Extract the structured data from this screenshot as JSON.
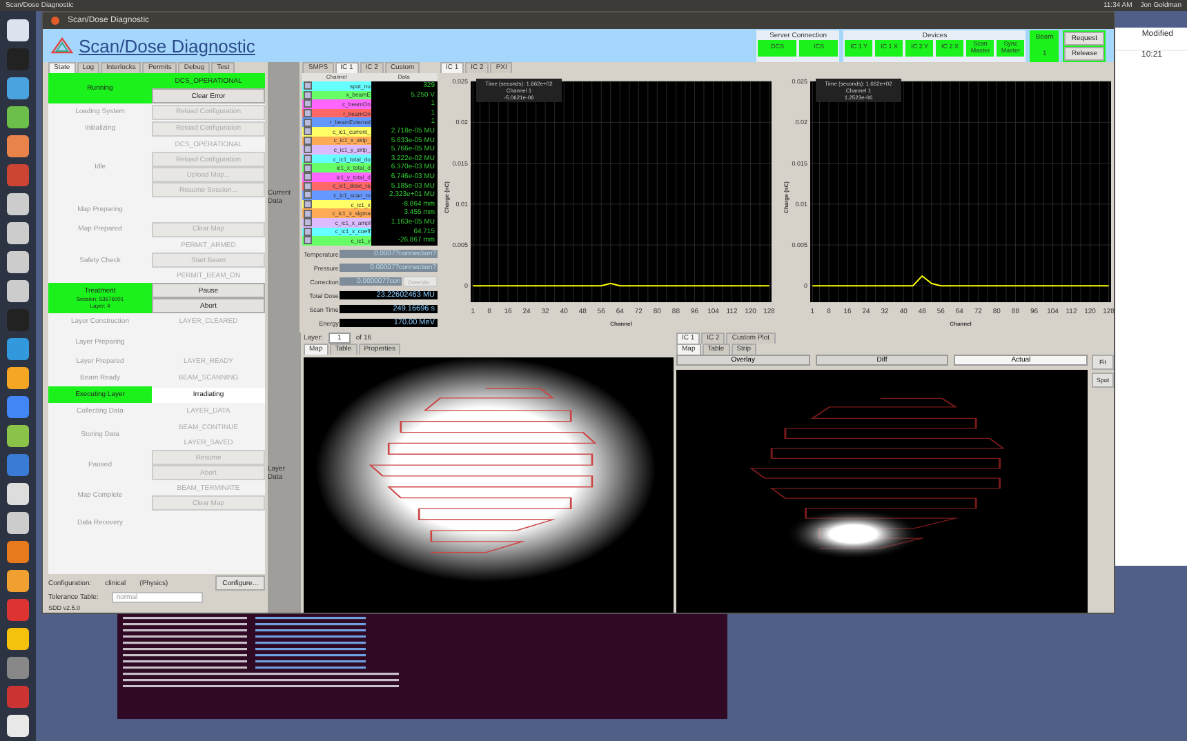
{
  "desktop": {
    "top_bar": {
      "app_title": "Scan/Dose Diagnostic",
      "clock": "11:34 AM",
      "user": "Jon Goldman"
    },
    "file_window": {
      "column": "Modified",
      "cell": "10:21"
    }
  },
  "window": {
    "title": "Scan/Dose Diagnostic",
    "app_name": "Scan/Dose Diagnostic"
  },
  "connections": {
    "server_label": "Server Connection",
    "servers": [
      {
        "label": "DCS",
        "on": true
      },
      {
        "label": "ICS",
        "on": true
      }
    ],
    "devices_label": "Devices",
    "devices": [
      {
        "label": "IC 1 Y",
        "on": true
      },
      {
        "label": "IC 1 X",
        "on": true
      },
      {
        "label": "IC 2 Y",
        "on": true
      },
      {
        "label": "IC 2 X",
        "on": true
      },
      {
        "label": "Scan Master",
        "on": true
      },
      {
        "label": "Sync Master",
        "on": true
      }
    ],
    "beam_label": "Beam",
    "beam_value": "1",
    "buttons": [
      "Request",
      "Release"
    ]
  },
  "tabs": [
    {
      "label": "State",
      "selected": true
    },
    {
      "label": "Log",
      "selected": false
    },
    {
      "label": "Interlocks",
      "selected": false
    },
    {
      "label": "Permits",
      "selected": false
    },
    {
      "label": "Debug",
      "selected": false
    },
    {
      "label": "Test",
      "selected": false
    }
  ],
  "states": [
    {
      "label": "Running",
      "active": true,
      "controls": [
        {
          "kind": "status",
          "text": "DCS_OPERATIONAL",
          "on": true
        },
        {
          "kind": "button",
          "text": "Clear Error",
          "disabled": false
        }
      ]
    },
    {
      "label": "Loading System",
      "active": false,
      "controls": [
        {
          "kind": "button",
          "text": "Reload Configuration",
          "disabled": true
        }
      ]
    },
    {
      "label": "Initializing",
      "active": false,
      "controls": [
        {
          "kind": "button",
          "text": "Reload Configuration",
          "disabled": true
        }
      ]
    },
    {
      "label": "Idle",
      "active": false,
      "controls": [
        {
          "kind": "status",
          "text": "DCS_OPERATIONAL",
          "on": false
        },
        {
          "kind": "button",
          "text": "Reload Configuration",
          "disabled": true
        },
        {
          "kind": "button",
          "text": "Upload Map...",
          "disabled": true
        },
        {
          "kind": "button",
          "text": "Resume Session...",
          "disabled": true
        }
      ]
    },
    {
      "label": "Map Preparing",
      "active": false
    },
    {
      "label": "Map Prepared",
      "active": false,
      "controls": [
        {
          "kind": "button",
          "text": "Clear Map",
          "disabled": true
        }
      ]
    },
    {
      "label": "Safety Check",
      "active": false,
      "controls": [
        {
          "kind": "status",
          "text": "PERMIT_ARMED",
          "on": false
        },
        {
          "kind": "button",
          "text": "Start Beam",
          "disabled": true
        },
        {
          "kind": "status",
          "text": "PERMIT_BEAM_ON",
          "on": false
        }
      ]
    },
    {
      "label": "Treatment",
      "details": [
        "Session: 53676001",
        "Layer: 4"
      ],
      "active": true,
      "controls": [
        {
          "kind": "button",
          "text": "Pause",
          "disabled": false
        },
        {
          "kind": "button",
          "text": "Abort",
          "disabled": false
        }
      ]
    },
    {
      "label": "Layer Construction",
      "active": false,
      "controls": [
        {
          "kind": "status",
          "text": "LAYER_CLEARED",
          "on": false
        }
      ]
    },
    {
      "label": "Layer Preparing",
      "active": false
    },
    {
      "label": "Layer Prepared",
      "active": false,
      "controls": [
        {
          "kind": "status",
          "text": "LAYER_READY",
          "on": false
        }
      ]
    },
    {
      "label": "Beam Ready",
      "active": false,
      "controls": [
        {
          "kind": "status",
          "text": "BEAM_SCANNING",
          "on": false
        }
      ]
    },
    {
      "label": "Executing Layer",
      "active": true,
      "controls": [
        {
          "kind": "current",
          "text": "Irradiating"
        }
      ]
    },
    {
      "label": "Collecting Data",
      "active": false,
      "controls": [
        {
          "kind": "status",
          "text": "LAYER_DATA",
          "on": false
        }
      ]
    },
    {
      "label": "Storing Data",
      "active": false,
      "controls": [
        {
          "kind": "status",
          "text": "BEAM_CONTINUE",
          "on": false
        },
        {
          "kind": "status",
          "text": "LAYER_SAVED",
          "on": false
        }
      ]
    },
    {
      "label": "Paused",
      "active": false,
      "controls": [
        {
          "kind": "button",
          "text": "Resume",
          "disabled": true
        },
        {
          "kind": "button",
          "text": "Abort",
          "disabled": true
        }
      ]
    },
    {
      "label": "Map Complete",
      "active": false,
      "controls": [
        {
          "kind": "status",
          "text": "BEAM_TERMINATE",
          "on": false
        },
        {
          "kind": "button",
          "text": "Clear Map",
          "disabled": true
        }
      ]
    },
    {
      "label": "Data Recovery",
      "active": false
    }
  ],
  "footer": {
    "configuration_label": "Configuration:",
    "configuration": "clinical",
    "mode": "(Physics)",
    "configure_button": "Configure...",
    "tolerance_label": "Tolerance Table:",
    "tolerance": "normal",
    "version": "SDD v2.5.0"
  },
  "current_data": {
    "label": "Current Data",
    "tabs": [
      {
        "label": "SMPS",
        "selected": false
      },
      {
        "label": "IC 1",
        "selected": true
      },
      {
        "label": "IC 2",
        "selected": false
      },
      {
        "label": "Custom",
        "selected": false
      }
    ],
    "columns": [
      "Channel",
      "Data"
    ],
    "channels": [
      {
        "name": "spot_nu",
        "value": "329",
        "color": "#66ffff",
        "checked": true
      },
      {
        "name": "x_beamE",
        "value": "5.250 V",
        "color": "#66ff66",
        "checked": true
      },
      {
        "name": "c_beamOn",
        "value": "1",
        "color": "#ff66ff",
        "checked": true
      },
      {
        "name": "r_beamOn",
        "value": "1",
        "color": "#ff6666",
        "checked": true
      },
      {
        "name": "r_beamExternal",
        "value": "1",
        "color": "#6699ff",
        "checked": true
      },
      {
        "name": "c_ic1_current_",
        "value": "2.718e-05 MU",
        "color": "#ffff66",
        "checked": true
      },
      {
        "name": "c_ic1_x_sktp_",
        "value": "5.633e-05 MU",
        "color": "#ffaa55",
        "checked": true
      },
      {
        "name": "c_ic1_y_sktp_",
        "value": "5.766e-05 MU",
        "color": "#ddbbff",
        "checked": true
      },
      {
        "name": "c_ic1_total_do",
        "value": "3.222e-02 MU",
        "color": "#66ffff",
        "checked": true
      },
      {
        "name": "ic1_x_total_d",
        "value": "6.370e-03 MU",
        "color": "#66ff66",
        "checked": true
      },
      {
        "name": "ic1_y_total_d",
        "value": "6.746e-03 MU",
        "color": "#ff66ff",
        "checked": true
      },
      {
        "name": "c_ic1_dose_ra",
        "value": "5.185e-03 MU",
        "color": "#ff6666",
        "checked": true
      },
      {
        "name": "c_ic1_scan_to",
        "value": "2.323e+01 MU",
        "color": "#6699ff",
        "checked": true
      },
      {
        "name": "c_ic1_x",
        "value": "-8.864 mm",
        "color": "#ffff66",
        "checked": true
      },
      {
        "name": "c_ic1_x_sigma",
        "value": "3.455 mm",
        "color": "#ffaa55",
        "checked": true
      },
      {
        "name": "c_ic1_x_ampl",
        "value": "1.163e-05 MU",
        "color": "#ddbbff",
        "checked": true
      },
      {
        "name": "c_ic1_x_coeff",
        "value": "64.715",
        "color": "#66ffff",
        "checked": true
      },
      {
        "name": "c_ic1_y",
        "value": "-26.867 mm",
        "color": "#66ff66",
        "checked": true
      }
    ],
    "readouts": [
      {
        "label": "Temperature",
        "value": "0.0007?connection?"
      },
      {
        "label": "Pressure",
        "value": "0.00007?connection?"
      },
      {
        "label": "Correction",
        "value": "0.000007?con",
        "button": "Override..."
      }
    ],
    "totals": [
      {
        "label": "Total Dose",
        "value": "23.22602463 MU"
      },
      {
        "label": "Scan Time",
        "value": "249.16696 s"
      },
      {
        "label": "Energy",
        "value": "170.00 MeV"
      }
    ]
  },
  "plots": {
    "tabs": [
      {
        "label": "IC 1",
        "selected": true
      },
      {
        "label": "IC 2",
        "selected": false
      },
      {
        "label": "PXI",
        "selected": false
      }
    ],
    "charts": [
      {
        "tooltip": [
          "Time (seconds): 1.662e+02",
          "Channel 1",
          "-5.0621e-06"
        ],
        "chart_data": {
          "type": "line",
          "xlabel": "Channel",
          "ylabel": "Charge (nC)",
          "x": [
            1,
            4,
            8,
            12,
            16,
            20,
            24,
            28,
            32,
            36,
            40,
            44,
            48,
            52,
            56,
            60,
            64,
            68,
            72,
            76,
            80,
            84,
            88,
            92,
            96,
            100,
            104,
            108,
            112,
            116,
            120,
            124,
            128
          ],
          "series": [
            {
              "color": "#ffff00",
              "values": [
                0,
                0,
                0,
                0,
                0,
                0,
                0,
                0,
                0,
                0,
                0,
                0,
                0,
                0,
                0,
                0.0003,
                0,
                0,
                0,
                0,
                0,
                0,
                0,
                0,
                0,
                0,
                0,
                0,
                0,
                0,
                0,
                0,
                0
              ]
            }
          ],
          "xlim": [
            0,
            129
          ],
          "ylim": [
            -0.002,
            0.025
          ],
          "grid": true,
          "yticks": [
            0,
            0.005,
            0.01,
            0.015,
            0.02,
            0.025
          ],
          "xticks": [
            1,
            8,
            16,
            24,
            32,
            40,
            48,
            56,
            64,
            72,
            80,
            88,
            96,
            104,
            112,
            120,
            128
          ]
        }
      },
      {
        "tooltip": [
          "Time (seconds): 1.662e+02",
          "Channel 1",
          "1.2523e-06"
        ],
        "chart_data": {
          "type": "line",
          "xlabel": "Channel",
          "ylabel": "Charge (nC)",
          "x": [
            1,
            4,
            8,
            12,
            16,
            20,
            24,
            28,
            32,
            36,
            40,
            44,
            48,
            52,
            56,
            60,
            64,
            68,
            72,
            76,
            80,
            84,
            88,
            92,
            96,
            100,
            104,
            108,
            112,
            116,
            120,
            124,
            128
          ],
          "series": [
            {
              "color": "#ffff00",
              "values": [
                0,
                0,
                0,
                0,
                0,
                0,
                0,
                0,
                0,
                0,
                0,
                0,
                0.0012,
                0.0003,
                0,
                0,
                0,
                0,
                0,
                0,
                0,
                0,
                0,
                0,
                0,
                0,
                0,
                0,
                0,
                0,
                0,
                0,
                0
              ]
            }
          ],
          "xlim": [
            0,
            129
          ],
          "ylim": [
            -0.002,
            0.025
          ],
          "grid": true,
          "yticks": [
            0,
            0.005,
            0.01,
            0.015,
            0.02,
            0.025
          ],
          "xticks": [
            1,
            8,
            16,
            24,
            32,
            40,
            48,
            56,
            64,
            72,
            80,
            88,
            96,
            104,
            112,
            120,
            128
          ]
        }
      }
    ]
  },
  "layer_data": {
    "label": "Layer Data",
    "layer_label": "Layer:",
    "layer_value": "1",
    "of_label": "of 16",
    "tabs": [
      {
        "label": "Map",
        "selected": true
      },
      {
        "label": "Table",
        "selected": false
      },
      {
        "label": "Properties",
        "selected": false
      }
    ]
  },
  "comparison": {
    "tabs": [
      {
        "label": "IC 1",
        "selected": true
      },
      {
        "label": "IC 2",
        "selected": false
      },
      {
        "label": "Custom Plot",
        "selected": false
      }
    ],
    "sub_tabs": [
      {
        "label": "Map",
        "selected": true
      },
      {
        "label": "Table",
        "selected": false
      },
      {
        "label": "Strip",
        "selected": false
      }
    ],
    "views": [
      {
        "label": "Overlay",
        "selected": false
      },
      {
        "label": "Diff",
        "selected": false
      },
      {
        "label": "Actual",
        "selected": true
      }
    ],
    "buttons": [
      "Fit",
      "Spot"
    ]
  }
}
